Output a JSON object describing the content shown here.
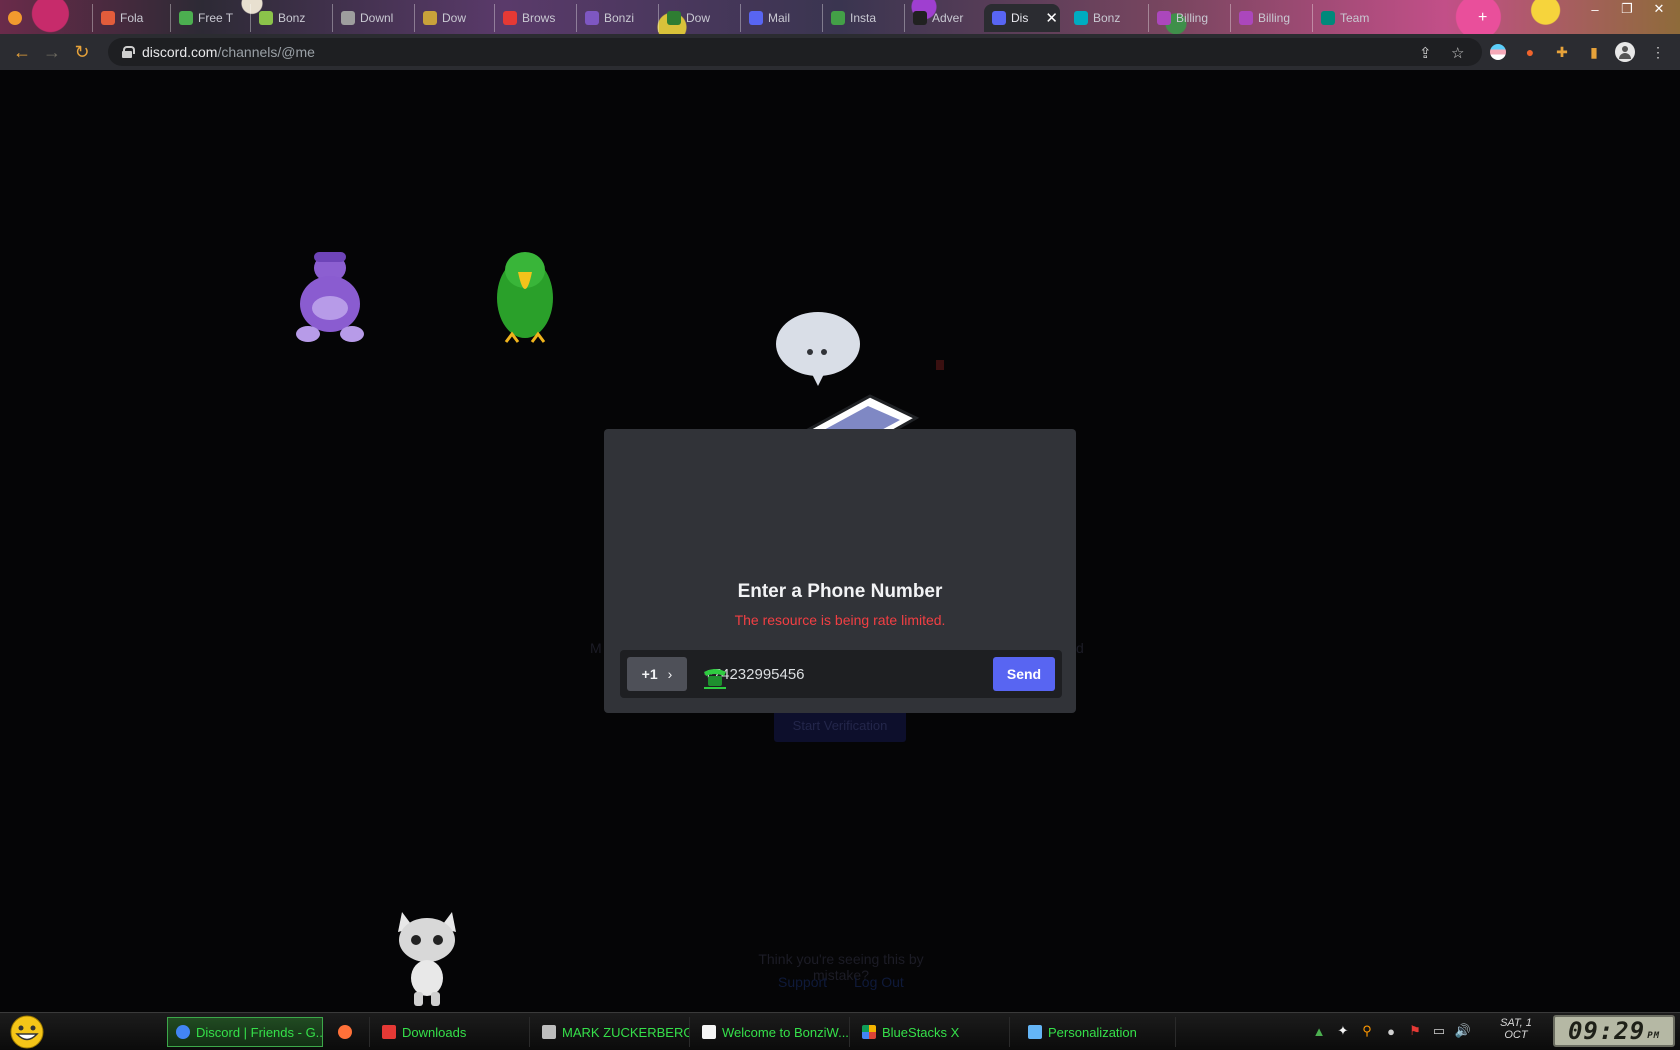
{
  "browser": {
    "tabs": [
      {
        "label": "Fola",
        "color": "#e25c3b"
      },
      {
        "label": "Free T",
        "color": "#4caf50"
      },
      {
        "label": "Bonz",
        "color": "#8bc34a"
      },
      {
        "label": "Downl",
        "color": "#9e9e9e"
      },
      {
        "label": "Dow",
        "color": "#c8a23a"
      },
      {
        "label": "Brows",
        "color": "#e53935"
      },
      {
        "label": "Bonzi",
        "color": "#7e57c2"
      },
      {
        "label": "Dow",
        "color": "#2e7d32"
      },
      {
        "label": "Mail",
        "color": "#5865f2"
      },
      {
        "label": "Insta",
        "color": "#43a047"
      },
      {
        "label": "Adver",
        "color": "#212121"
      },
      {
        "label": "Bonz",
        "color": "#00acc1"
      },
      {
        "label": "Billing",
        "color": "#ab47bc"
      },
      {
        "label": "Billing",
        "color": "#ab47bc"
      },
      {
        "label": "Team",
        "color": "#00897b"
      }
    ],
    "active_tab": {
      "label": "Dis",
      "color": "#5865f2"
    },
    "url_host": "discord.com",
    "url_path": "/channels/@me"
  },
  "background_page": {
    "start_verification_label": "Start Verification",
    "footer_question": "Think you're seeing this by mistake?",
    "support_link": "Support",
    "logout_link": "Log Out"
  },
  "modal": {
    "title": "Enter a Phone Number",
    "error": "The resource is being rate limited.",
    "country_code": "+1",
    "phone_value": "+74232995456",
    "send_label": "Send"
  },
  "taskbar": {
    "items": [
      {
        "label": "Discord | Friends - G...",
        "color": "#4285f4"
      },
      {
        "label": "",
        "color": "#ff7139"
      },
      {
        "label": "Downloads",
        "color": "#e53935"
      },
      {
        "label": "MARK ZUCKERBERG",
        "color": "#bdbdbd"
      },
      {
        "label": "Welcome to BonziW...",
        "color": "#f5f5f5"
      },
      {
        "label": "BlueStacks X",
        "color": "#f4b400"
      },
      {
        "label": "Personalization",
        "color": "#64b5f6"
      }
    ],
    "date_day": "SAT, 1",
    "date_month": "OCT",
    "time": "09:29",
    "ampm": "PM"
  },
  "colors": {
    "discord_blurple": "#5865f2",
    "error_red": "#f23f43",
    "taskbar_text": "#35e04a"
  }
}
